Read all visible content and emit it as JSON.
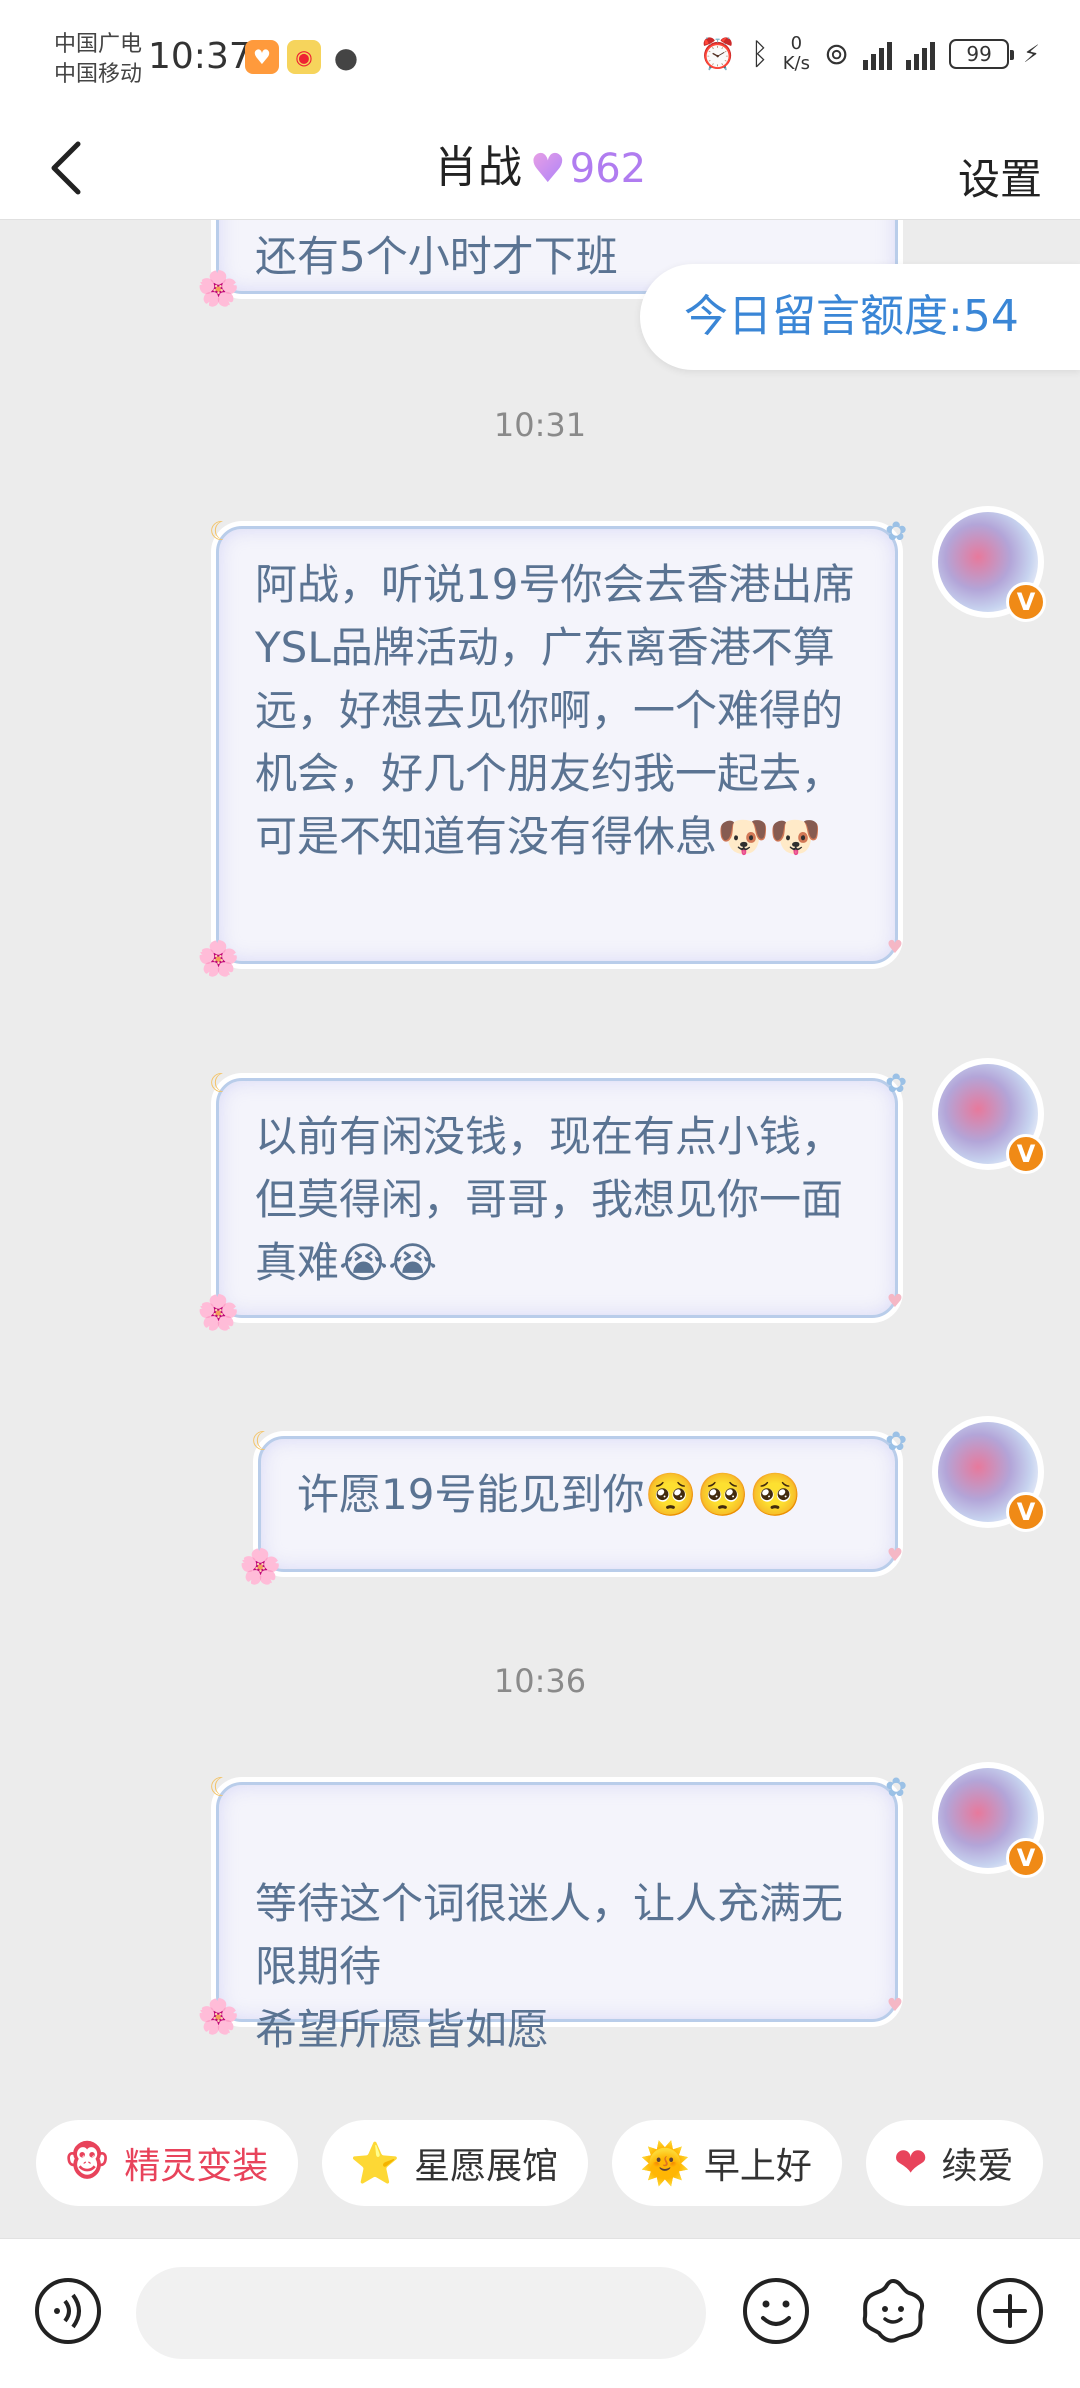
{
  "status_bar": {
    "carrier1": "中国广电",
    "carrier2": "中国移动",
    "time": "10:37",
    "net_speed_value": "0",
    "net_speed_unit": "K/s",
    "battery": "99"
  },
  "header": {
    "back_icon": "chevron-left-icon",
    "title": "肖战",
    "heart_icon": "heart-icon",
    "level": "962",
    "settings_label": "设置"
  },
  "chat": {
    "partial_message": "还有5个小时才下班",
    "quota_label": "今日留言额度:54",
    "groups": [
      {
        "time": "10:31"
      },
      {
        "time": "10:36"
      }
    ],
    "messages": [
      {
        "text": "阿战，听说19号你会去香港出席YSL品牌活动，广东离香港不算远，好想去见你啊，一个难得的机会，好几个朋友约我一起去，可是不知道有没有得休息🐶🐶"
      },
      {
        "text": "以前有闲没钱，现在有点小钱，但莫得闲，哥哥，我想见你一面真难😭😭"
      },
      {
        "text": "许愿19号能见到你🥺🥺🥺"
      },
      {
        "text": "等待这个词很迷人，让人充满无限期待\n希望所愿皆如愿"
      }
    ]
  },
  "quick_actions": [
    {
      "label": "精灵变装",
      "icon": "monkey-icon"
    },
    {
      "label": "星愿展馆",
      "icon": "star-icon"
    },
    {
      "label": "早上好",
      "icon": "sun-face-icon"
    },
    {
      "label": "续爱",
      "icon": "heart-icon"
    }
  ],
  "input_bar": {
    "voice_icon": "voice-icon",
    "emoji_icon": "smile-icon",
    "sticker_icon": "flower-face-icon",
    "plus_icon": "plus-icon",
    "placeholder": ""
  },
  "colors": {
    "accent_blue": "#3a86d6",
    "bubble_text": "#5a7392",
    "bubble_border": "#b9cdea",
    "level_purple": "#b07cf0",
    "chip_red": "#e8435b",
    "verified_orange": "#f08a16"
  }
}
